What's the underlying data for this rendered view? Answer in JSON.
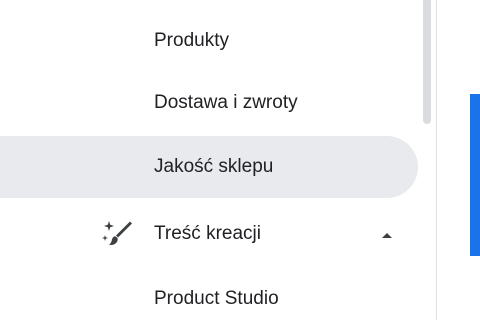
{
  "nav": {
    "items": [
      {
        "label": "Produkty"
      },
      {
        "label": "Dostawa i zwroty"
      },
      {
        "label": "Jakość sklepu",
        "selected": true
      },
      {
        "label": "Treść kreacji",
        "icon": "magic-wand-icon",
        "expanded": true
      },
      {
        "label": "Product Studio"
      }
    ]
  },
  "colors": {
    "selected_background": "#e8eaed",
    "accent": "#1a73e8",
    "text": "#202124"
  }
}
